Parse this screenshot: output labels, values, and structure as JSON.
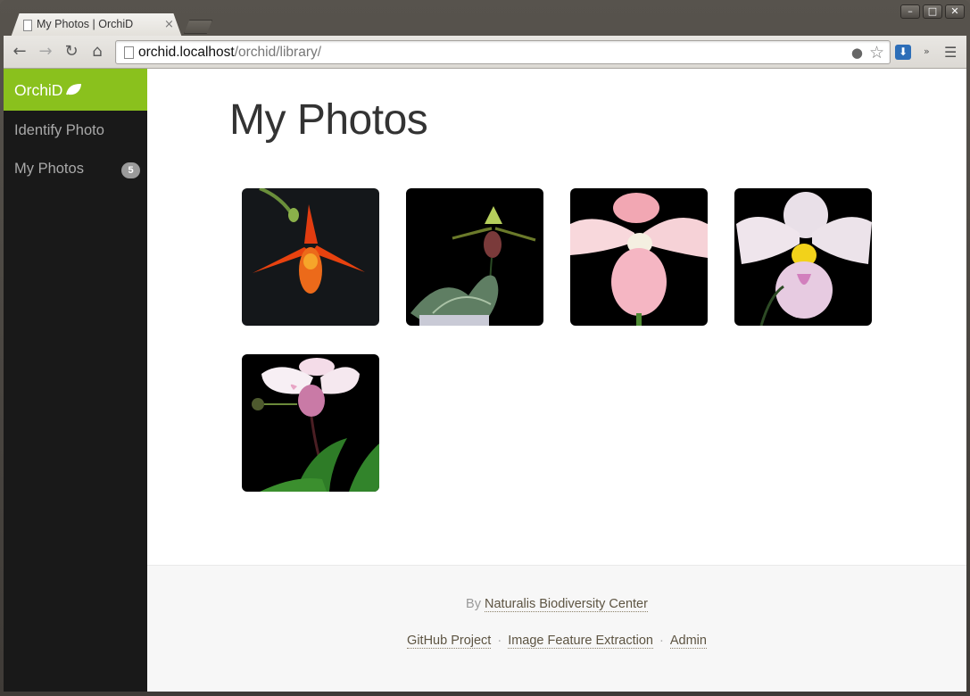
{
  "browser": {
    "tab_title": "My Photos | OrchiD",
    "tab_close": "×",
    "url_host": "orchid.localhost",
    "url_path": "/orchid/library/",
    "window_buttons": [
      "–",
      "□",
      "✕"
    ]
  },
  "sidebar": {
    "brand": "OrchiD",
    "items": [
      {
        "label": "Identify Photo"
      },
      {
        "label": "My Photos",
        "badge": "5"
      }
    ]
  },
  "main": {
    "title": "My Photos",
    "photos": [
      {
        "icon": "orange-orchid-photo"
      },
      {
        "icon": "green-spotted-orchid-photo"
      },
      {
        "icon": "pink-orchid-photo"
      },
      {
        "icon": "white-yellow-orchid-photo"
      },
      {
        "icon": "white-pink-orchid-photo"
      }
    ]
  },
  "footer": {
    "by_prefix": "By",
    "by_link": "Naturalis Biodiversity Center",
    "links": [
      "GitHub Project",
      "Image Feature Extraction",
      "Admin"
    ],
    "separator": "·"
  },
  "colors": {
    "brand": "#8ac11d",
    "sidebar_bg": "#191919",
    "badge_bg": "#9a9a9a"
  }
}
